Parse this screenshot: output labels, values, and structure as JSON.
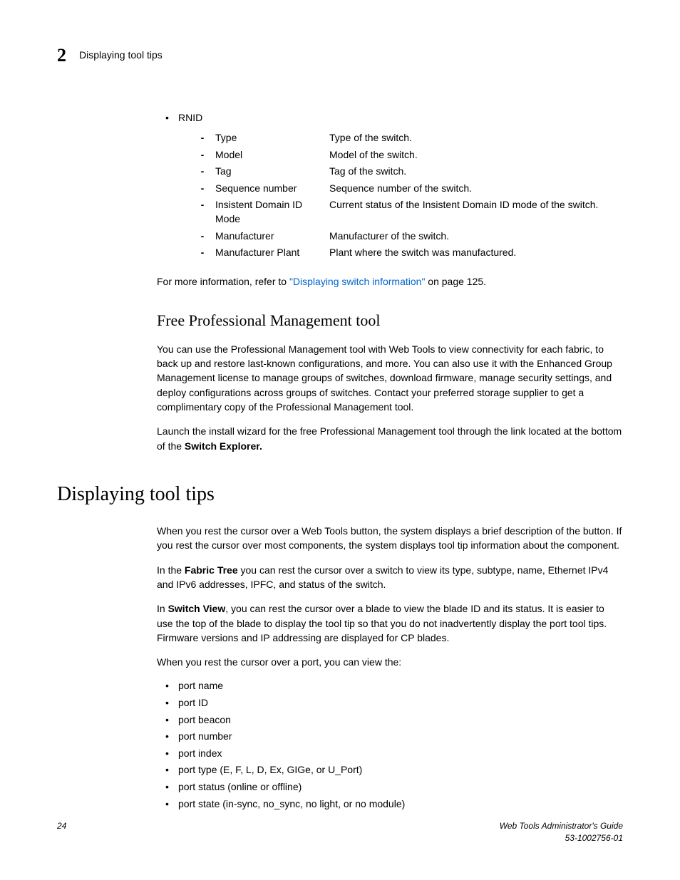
{
  "header": {
    "chapter_number": "2",
    "running_title": "Displaying tool tips"
  },
  "rnid": {
    "label": "RNID",
    "fields": [
      {
        "name": "Type",
        "desc": "Type of the switch."
      },
      {
        "name": "Model",
        "desc": "Model of the switch."
      },
      {
        "name": "Tag",
        "desc": "Tag of the switch."
      },
      {
        "name": "Sequence number",
        "desc": "Sequence number of the switch."
      },
      {
        "name": "Insistent Domain ID Mode",
        "desc": "Current status of the Insistent Domain ID mode of the switch."
      },
      {
        "name": "Manufacturer",
        "desc": "Manufacturer of the switch."
      },
      {
        "name": "Manufacturer Plant",
        "desc": "Plant where the switch was manufactured."
      }
    ]
  },
  "xref": {
    "pre": "For more information, refer to ",
    "link": "\"Displaying switch information\"",
    "post": " on page 125."
  },
  "section_pm": {
    "title": "Free Professional Management tool",
    "p1": "You can use the Professional Management tool with Web Tools to view connectivity for each fabric, to back up and restore last-known configurations, and more. You can also use it with the Enhanced Group Management license to manage groups of switches, download firmware, manage security settings, and deploy configurations across groups of switches. Contact your preferred storage supplier to get a complimentary copy of the Professional Management tool.",
    "p2_a": "Launch the install wizard for the free Professional Management tool through the link located at the bottom of the ",
    "p2_b": "Switch Explorer."
  },
  "section_tips": {
    "title": "Displaying tool tips",
    "p1": "When you rest the cursor over a Web Tools button, the system displays a brief description of the button. If you rest the cursor over most components, the system displays tool tip information about the component.",
    "p2_a": "In the ",
    "p2_b": "Fabric Tree",
    "p2_c": " you can rest the cursor over a switch to view its type, subtype, name, Ethernet IPv4 and IPv6 addresses, IPFC, and status of the switch.",
    "p3_a": "In ",
    "p3_b": "Switch View",
    "p3_c": ", you can rest the cursor over a blade to view the blade ID and its status. It is easier to use the top of the blade to display the tool tip so that you do not inadvertently display the port tool tips. Firmware versions and IP addressing are displayed for CP blades.",
    "p4": "When you rest the cursor over a port, you can view the:",
    "port_items": [
      "port name",
      "port ID",
      "port beacon",
      "port number",
      "port index",
      "port type (E, F, L, D, Ex, GIGe, or U_Port)",
      "port status (online or offline)",
      "port state (in-sync, no_sync, no light, or no module)"
    ]
  },
  "footer": {
    "page": "24",
    "title": "Web Tools Administrator's Guide",
    "docnum": "53-1002756-01"
  }
}
